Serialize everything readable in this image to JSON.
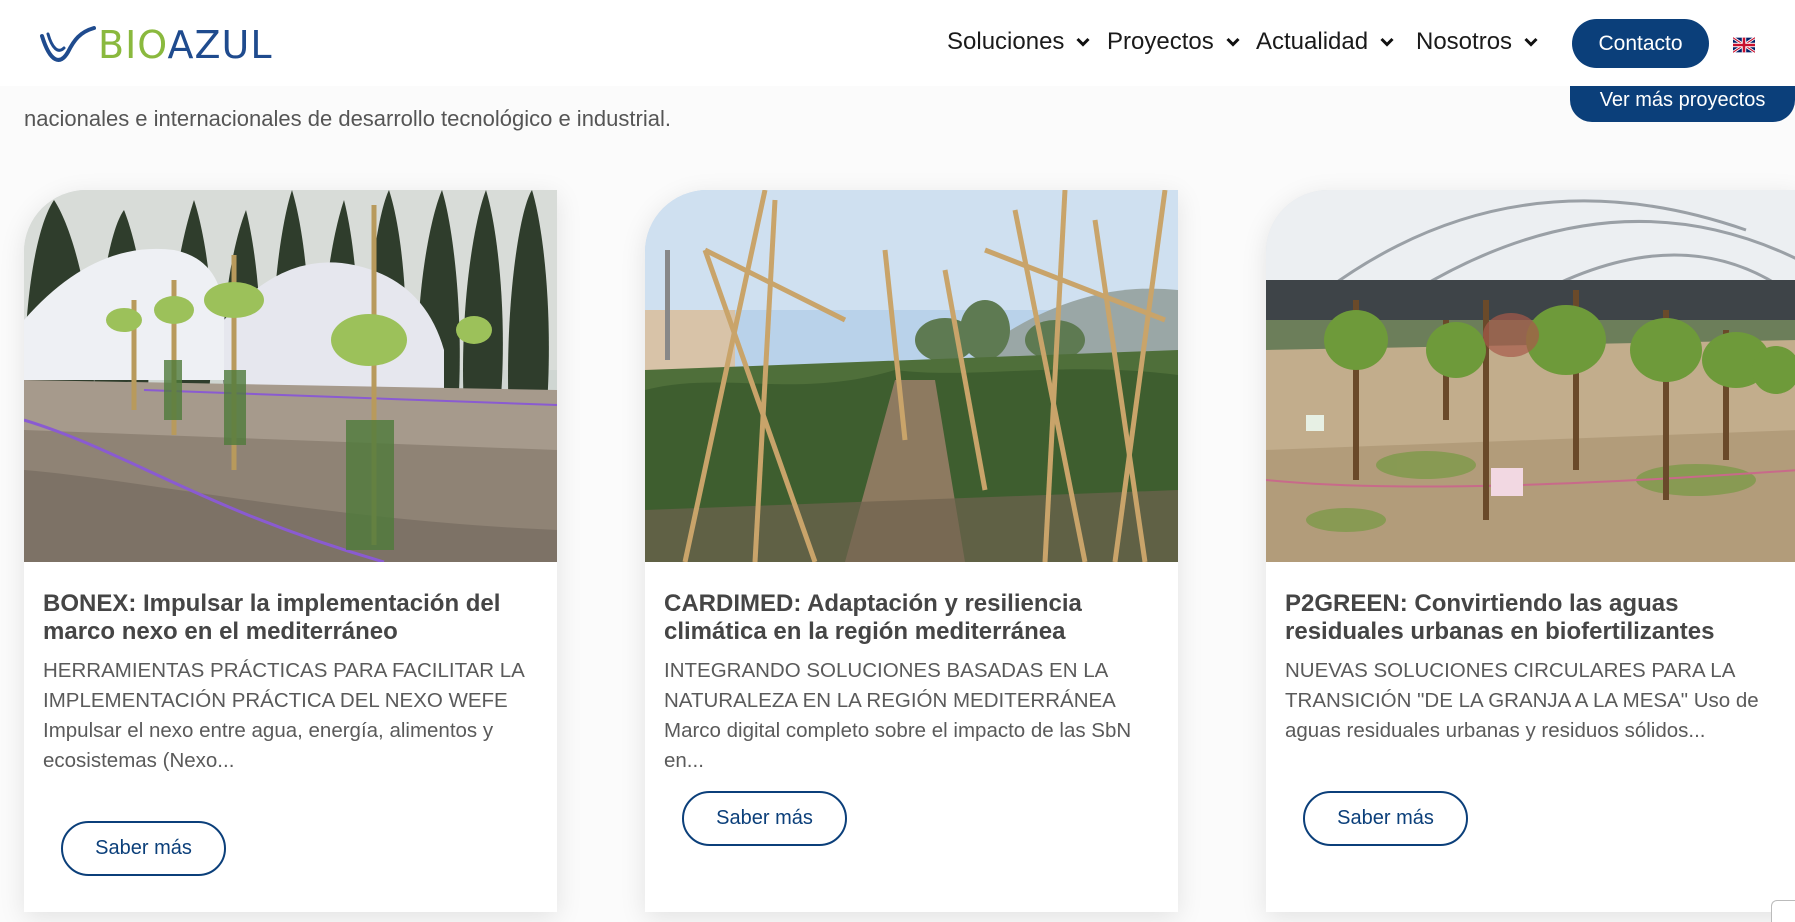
{
  "brand": {
    "logo_part1": "BIO",
    "logo_part2": "AZUL"
  },
  "nav": {
    "items": [
      {
        "label": "Soluciones"
      },
      {
        "label": "Proyectos"
      },
      {
        "label": "Actualidad"
      },
      {
        "label": "Nosotros"
      }
    ],
    "contact_label": "Contacto",
    "language_flag": "uk-flag-icon"
  },
  "intro": {
    "text": "nacionales e internacionales de desarrollo tecnológico e industrial.",
    "more_projects_label": "Ver más proyectos"
  },
  "colors": {
    "brand_blue": "#0b3f7a",
    "brand_green": "#8ab93e",
    "logo_blue": "#1f4b8e"
  },
  "cards": [
    {
      "image": "avocado-trees-field-photo",
      "title": "BONEX: Impulsar la implementación del marco nexo en el mediterráneo",
      "text": "HERRAMIENTAS PRÁCTICAS PARA FACILITAR LA IMPLEMENTACIÓN PRÁCTICA DEL NEXO WEFE Impulsar el nexo entre agua, energía, alimentos y ecosistemas (Nexo...",
      "button_label": "Saber más"
    },
    {
      "image": "tomato-stakes-garden-photo",
      "title": "CARDIMED: Adaptación y resiliencia climática en la región mediterránea",
      "text": "INTEGRANDO SOLUCIONES BASADAS EN LA NATURALEZA EN LA REGIÓN MEDITERRÁNEA Marco digital completo sobre el impacto de las SbN en...",
      "button_label": "Saber más"
    },
    {
      "image": "greenhouse-plants-photo",
      "title": "P2GREEN: Convirtiendo las aguas residuales urbanas en biofertilizantes",
      "text": "NUEVAS SOLUCIONES CIRCULARES PARA LA TRANSICIÓN \"DE LA GRANJA A LA MESA\" Uso de aguas residuales urbanas y residuos sólidos...",
      "button_label": "Saber más"
    }
  ]
}
